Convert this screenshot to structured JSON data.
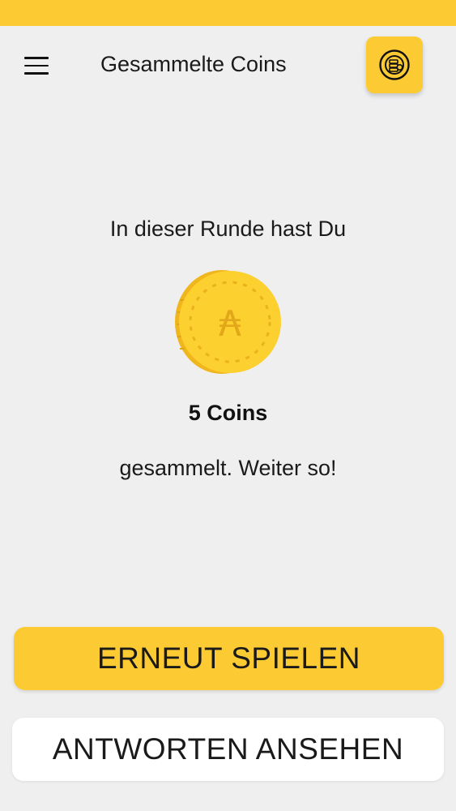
{
  "header": {
    "title": "Gesammelte Coins",
    "menu_icon": "hamburger-menu-icon",
    "action_icon": "coin-stack-icon"
  },
  "result": {
    "intro": "In dieser Runde hast Du",
    "coin_icon": "coin-icon",
    "coin_symbol": "₳",
    "count_label": "5 Coins",
    "outro": "gesammelt. Weiter so!"
  },
  "actions": {
    "play_again": "ERNEUT SPIELEN",
    "view_answers": "ANTWORTEN ANSEHEN"
  },
  "colors": {
    "accent": "#fccb33",
    "background": "#efeff0",
    "coin_face": "#fcd02e",
    "coin_edge": "#f0b61e",
    "coin_mark": "#e3a81a"
  }
}
